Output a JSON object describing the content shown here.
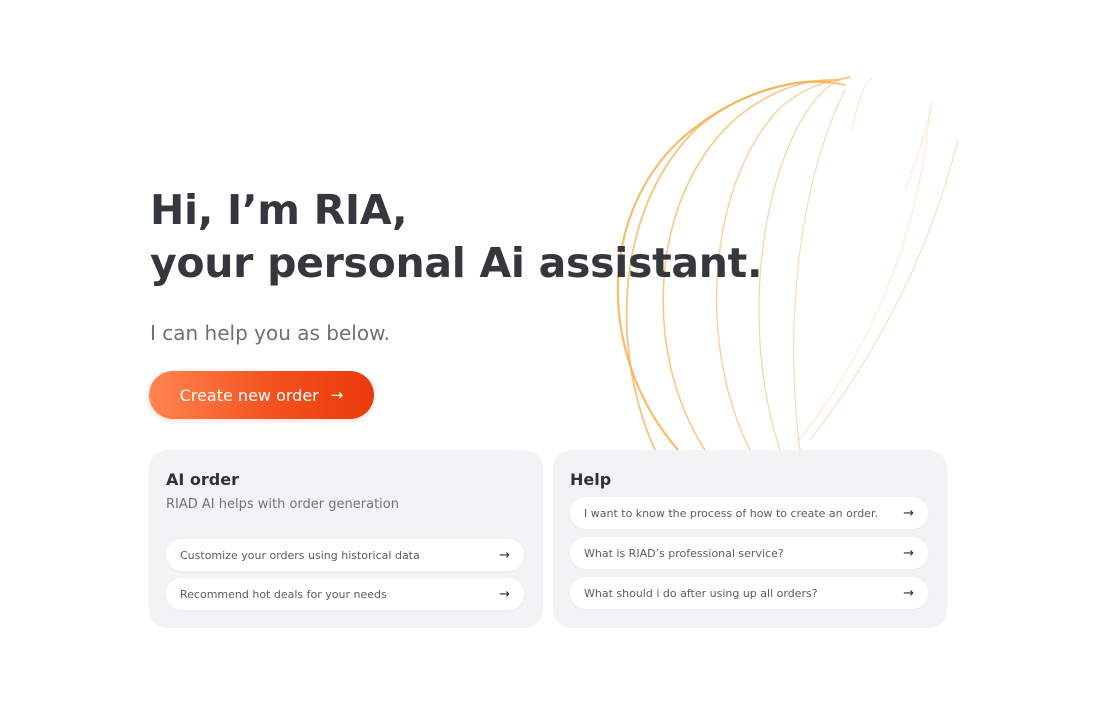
{
  "hero": {
    "line1": "Hi, I’m RIA,",
    "line2": "your personal Ai assistant.",
    "subtitle": "I can help you as below.",
    "cta_label": "Create new order",
    "cta_icon": "arrow-right-icon"
  },
  "ai_card": {
    "title": "AI order",
    "description": "RIAD AI helps with order generation",
    "items": [
      {
        "label": "Customize your orders using historical data",
        "icon": "arrow-right-icon"
      },
      {
        "label": "Recommend hot deals for your needs",
        "icon": "arrow-right-icon"
      }
    ]
  },
  "help_card": {
    "title": "Help",
    "items": [
      {
        "label": "I want to know the process of how to create an order.",
        "icon": "arrow-right-icon"
      },
      {
        "label": "What is RIAD’s professional service?",
        "icon": "arrow-right-icon"
      },
      {
        "label": "What should i do after using up all orders?",
        "icon": "arrow-right-icon"
      }
    ]
  },
  "colors": {
    "accent_start": "#ff8550",
    "accent_end": "#ea3a0c",
    "decor_lines": "#f7b35a",
    "card_bg": "#f2f3f5"
  }
}
